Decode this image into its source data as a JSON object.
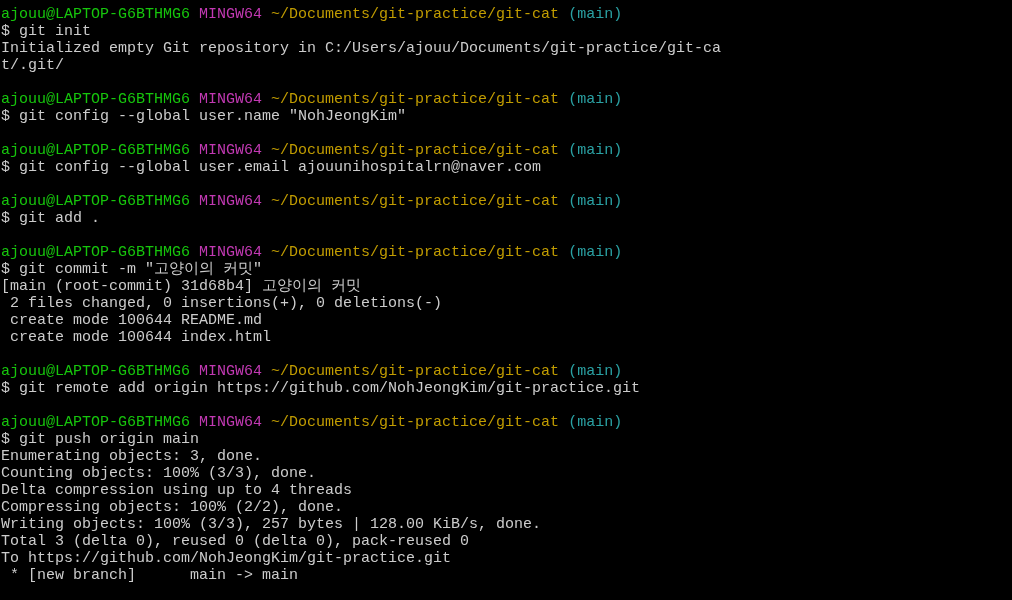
{
  "terminal": {
    "blocks": [
      {
        "prompt": {
          "user_host": "ajouu@LAPTOP-G6BTHMG6",
          "system": "MINGW64",
          "path": "~/Documents/git-practice/git-cat",
          "branch": "(main)"
        },
        "command": "$ git init",
        "output": [
          "Initialized empty Git repository in C:/Users/ajouu/Documents/git-practice/git-ca",
          "t/.git/"
        ]
      },
      {
        "prompt": {
          "user_host": "ajouu@LAPTOP-G6BTHMG6",
          "system": "MINGW64",
          "path": "~/Documents/git-practice/git-cat",
          "branch": "(main)"
        },
        "command": "$ git config --global user.name \"NohJeongKim\""
      },
      {
        "prompt": {
          "user_host": "ajouu@LAPTOP-G6BTHMG6",
          "system": "MINGW64",
          "path": "~/Documents/git-practice/git-cat",
          "branch": "(main)"
        },
        "command": "$ git config --global user.email ajouunihospitalrn@naver.com"
      },
      {
        "prompt": {
          "user_host": "ajouu@LAPTOP-G6BTHMG6",
          "system": "MINGW64",
          "path": "~/Documents/git-practice/git-cat",
          "branch": "(main)"
        },
        "command": "$ git add ."
      },
      {
        "prompt": {
          "user_host": "ajouu@LAPTOP-G6BTHMG6",
          "system": "MINGW64",
          "path": "~/Documents/git-practice/git-cat",
          "branch": "(main)"
        },
        "command": "$ git commit -m \"고양이의 커밋\"",
        "output": [
          "[main (root-commit) 31d68b4] 고양이의 커밋",
          " 2 files changed, 0 insertions(+), 0 deletions(-)",
          " create mode 100644 README.md",
          " create mode 100644 index.html"
        ]
      },
      {
        "prompt": {
          "user_host": "ajouu@LAPTOP-G6BTHMG6",
          "system": "MINGW64",
          "path": "~/Documents/git-practice/git-cat",
          "branch": "(main)"
        },
        "command": "$ git remote add origin https://github.com/NohJeongKim/git-practice.git"
      },
      {
        "prompt": {
          "user_host": "ajouu@LAPTOP-G6BTHMG6",
          "system": "MINGW64",
          "path": "~/Documents/git-practice/git-cat",
          "branch": "(main)"
        },
        "command": "$ git push origin main",
        "output": [
          "Enumerating objects: 3, done.",
          "Counting objects: 100% (3/3), done.",
          "Delta compression using up to 4 threads",
          "Compressing objects: 100% (2/2), done.",
          "Writing objects: 100% (3/3), 257 bytes | 128.00 KiB/s, done.",
          "Total 3 (delta 0), reused 0 (delta 0), pack-reused 0",
          "To https://github.com/NohJeongKim/git-practice.git",
          " * [new branch]      main -> main"
        ]
      }
    ]
  }
}
